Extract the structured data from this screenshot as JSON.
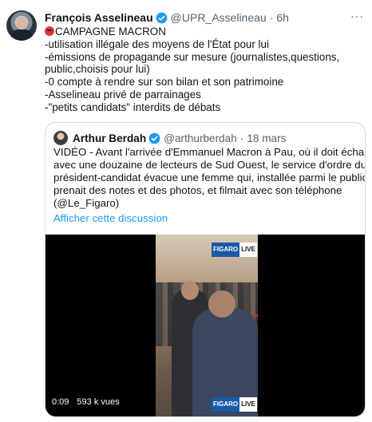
{
  "tweet": {
    "author_name": "François Asselineau",
    "author_handle": "@UPR_Asselineau",
    "separator": "·",
    "time": "6h",
    "more_icon": "more-icon",
    "lines": [
      "CAMPAGNE MACRON",
      "-utilisation illégale des moyens de l'État pour lui",
      "-émissions de propagande sur mesure (journalistes,questions,",
      "public,choisis pour lui)",
      "-0 compte à rendre sur son bilan et son patrimoine",
      "-Asselineau privé de parrainages",
      "-\"petits candidats\" interdits de débats"
    ]
  },
  "quote": {
    "author_name": "Arthur Berdah",
    "author_handle": "@arthurberdah",
    "separator": "·",
    "time": "18 mars",
    "lines": [
      "VIDÉO - Avant l'arrivée d'Emmanuel Macron à Pau, où il doit échanger",
      "avec une douzaine de lecteurs de Sud Ouest, le service d'ordre du",
      "président-candidat évacue une femme qui, installée parmi le public,",
      "prenait des notes et des photos, et filmait avec son téléphone",
      "(@Le_Figaro)"
    ],
    "show_thread": "Afficher cette discussion"
  },
  "video": {
    "logo_figaro": "FIGARO",
    "logo_live": "LIVE",
    "duration": "0:09",
    "views": "593 k vues"
  },
  "colors": {
    "accent": "#1d9bf0",
    "secondary_text": "#536471",
    "border": "#cfd9de"
  }
}
